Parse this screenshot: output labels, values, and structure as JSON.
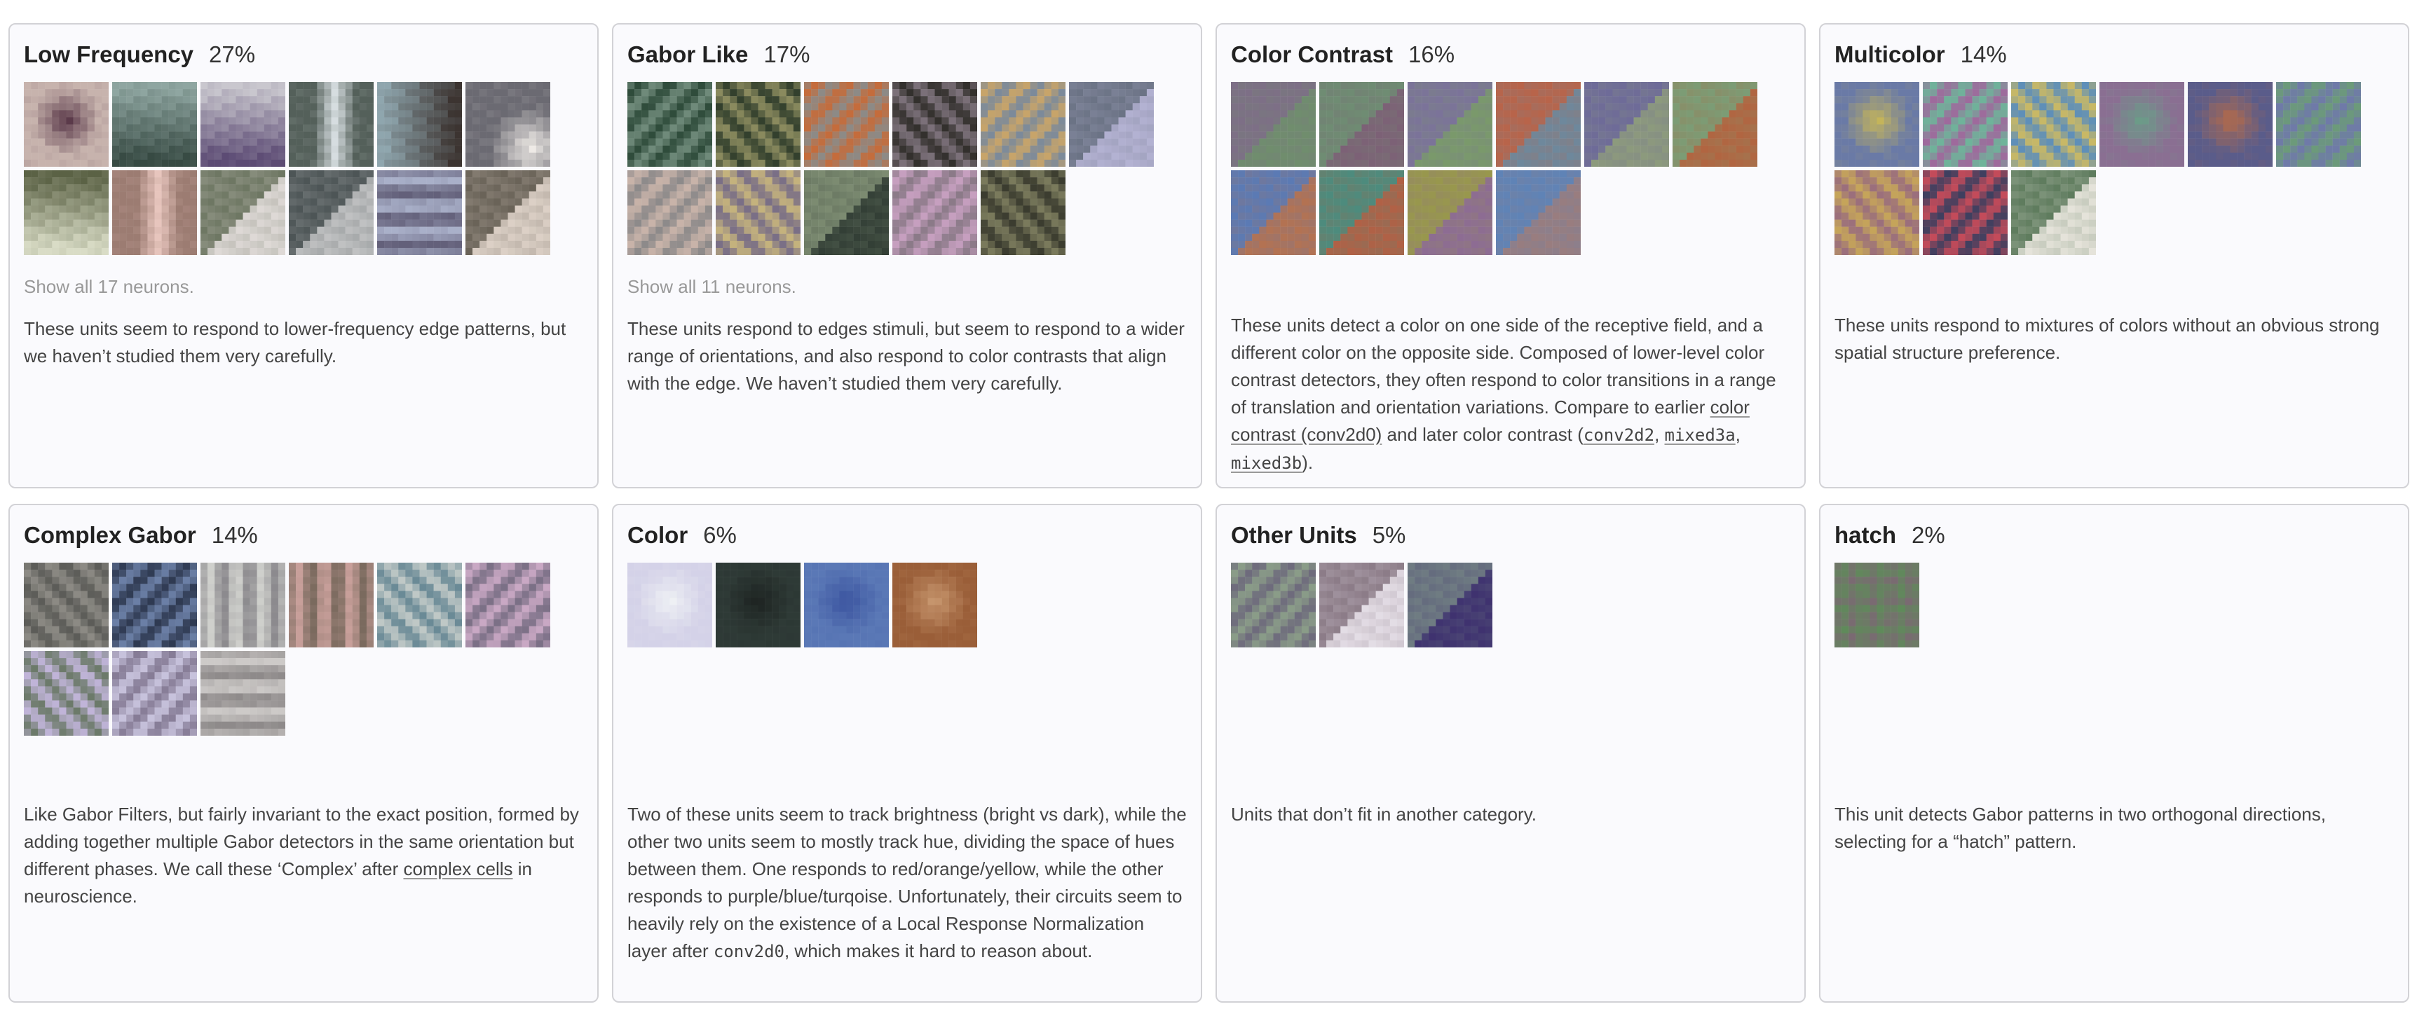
{
  "cards": [
    {
      "title": "Low Frequency",
      "percent": "27%",
      "show_all": "Show all 17 neurons.",
      "description": "These units seem to respond to lower-frequency edge patterns, but we haven’t studied them very carefully.",
      "swatches": [
        {
          "bg": "#c7b3ad",
          "tint": "#5b3a4a",
          "pattern": "blob"
        },
        {
          "bg": "#8fa6a1",
          "tint": "#374a43",
          "pattern": "grad-bottom"
        },
        {
          "bg": "#c9c7ce",
          "tint": "#5c4b74",
          "pattern": "grad-bottom"
        },
        {
          "bg": "#54605a",
          "tint": "#d6dde0",
          "pattern": "vbar"
        },
        {
          "bg": "#8fa6ae",
          "tint": "#3c3431",
          "pattern": "grad-right"
        },
        {
          "bg": "#6b6a72",
          "tint": "#eeeae6",
          "pattern": "blob-br"
        },
        {
          "bg": "#5b6245",
          "tint": "#d9dcc6",
          "pattern": "grad-bottom"
        },
        {
          "bg": "#9c7c72",
          "tint": "#e7c5bd",
          "pattern": "vbar"
        },
        {
          "bg": "#6e7763",
          "tint": "#e4dedc",
          "pattern": "diag"
        },
        {
          "bg": "#4d5556",
          "tint": "#c6c7c8",
          "pattern": "diag"
        },
        {
          "bg": "#63607a",
          "tint": "#a9b0c9",
          "pattern": "stripes-h"
        },
        {
          "bg": "#6a6358",
          "tint": "#e2d6cc",
          "pattern": "diag"
        }
      ]
    },
    {
      "title": "Gabor Like",
      "percent": "17%",
      "show_all": "Show all 11 neurons.",
      "description": "These units respond to edges stimuli, but seem to respond to a wider range of orientations, and also respond to color contrasts that align with the edge. We haven’t studied them very carefully.",
      "swatches": [
        {
          "bg": "#6f8a7a",
          "tint": "#2f4c3b",
          "pattern": "stripes-diag"
        },
        {
          "bg": "#8a8a5e",
          "tint": "#33402d",
          "pattern": "stripes-diag2"
        },
        {
          "bg": "#8d8a86",
          "tint": "#c46c3c",
          "pattern": "stripes-diag"
        },
        {
          "bg": "#7b7079",
          "tint": "#33302d",
          "pattern": "stripes-diag2"
        },
        {
          "bg": "#7c8a9a",
          "tint": "#c7a46a",
          "pattern": "stripes-diag"
        },
        {
          "bg": "#6b7385",
          "tint": "#b7b5d6",
          "pattern": "diag"
        },
        {
          "bg": "#8d8a8a",
          "tint": "#c8b3a9",
          "pattern": "stripes-diag"
        },
        {
          "bg": "#7a6f86",
          "tint": "#c4b27d",
          "pattern": "stripes-diag2"
        },
        {
          "bg": "#7c8b71",
          "tint": "#2f3b33",
          "pattern": "diag"
        },
        {
          "bg": "#8b7a88",
          "tint": "#c69fbf",
          "pattern": "stripes-diag"
        },
        {
          "bg": "#7a7a5c",
          "tint": "#3b3c2f",
          "pattern": "stripes-diag2"
        }
      ]
    },
    {
      "title": "Color Contrast",
      "percent": "16%",
      "show_all": "",
      "description": "",
      "swatches": [
        {
          "bg": "#7d6f86",
          "tint": "#6f8f6c",
          "pattern": "diag"
        },
        {
          "bg": "#6f8c73",
          "tint": "#7d5f76",
          "pattern": "diag"
        },
        {
          "bg": "#7b7399",
          "tint": "#7a9b69",
          "pattern": "diag"
        },
        {
          "bg": "#b8644a",
          "tint": "#6a8aa0",
          "pattern": "diag"
        },
        {
          "bg": "#6e6b98",
          "tint": "#8e9c7c",
          "pattern": "diag"
        },
        {
          "bg": "#7c9c75",
          "tint": "#b4623e",
          "pattern": "diag"
        },
        {
          "bg": "#5b7ab4",
          "tint": "#b8724d",
          "pattern": "diag"
        },
        {
          "bg": "#4d8b7d",
          "tint": "#b55f43",
          "pattern": "diag"
        },
        {
          "bg": "#98974d",
          "tint": "#8c6a97",
          "pattern": "diag"
        },
        {
          "bg": "#5f83b6",
          "tint": "#9c7d7c",
          "pattern": "diag"
        }
      ]
    },
    {
      "title": "Multicolor",
      "percent": "14%",
      "show_all": "",
      "description": "These units respond to mixtures of colors without an obvious strong spatial structure preference.",
      "swatches": [
        {
          "bg": "#6a7aa6",
          "tint": "#c4b45a",
          "pattern": "blob"
        },
        {
          "bg": "#9e6a9c",
          "tint": "#6fb39a",
          "pattern": "stripes-diag"
        },
        {
          "bg": "#c8b866",
          "tint": "#5f8fb8",
          "pattern": "stripes-diag2"
        },
        {
          "bg": "#8a6f92",
          "tint": "#6b9c88",
          "pattern": "blob"
        },
        {
          "bg": "#5a5c8a",
          "tint": "#b26a4a",
          "pattern": "blob"
        },
        {
          "bg": "#6f7aa8",
          "tint": "#6c9a7a",
          "pattern": "stripes-diag"
        },
        {
          "bg": "#9b6f7c",
          "tint": "#c5a45a",
          "pattern": "stripes-diag2"
        },
        {
          "bg": "#3f3f5f",
          "tint": "#c34b5a",
          "pattern": "stripes-diag"
        },
        {
          "bg": "#5f7c5e",
          "tint": "#ece8e0",
          "pattern": "diag"
        }
      ]
    },
    {
      "title": "Complex Gabor",
      "percent": "14%",
      "show_all": "",
      "description": "",
      "swatches": [
        {
          "bg": "#8c8a84",
          "tint": "#5c5c58",
          "pattern": "stripes-diag2"
        },
        {
          "bg": "#6b7fa6",
          "tint": "#2f3a52",
          "pattern": "stripes-diag"
        },
        {
          "bg": "#8c8a8e",
          "tint": "#cfd0cc",
          "pattern": "stripes-v"
        },
        {
          "bg": "#7a6a5e",
          "tint": "#c89f9a",
          "pattern": "stripes-v"
        },
        {
          "bg": "#6a8a96",
          "tint": "#bfc8c6",
          "pattern": "stripes-diag2"
        },
        {
          "bg": "#7b7086",
          "tint": "#c9a8c4",
          "pattern": "stripes-diag"
        },
        {
          "bg": "#6c7a6a",
          "tint": "#c0b4d8",
          "pattern": "stripes-diag2"
        },
        {
          "bg": "#867c96",
          "tint": "#c7c2dc",
          "pattern": "stripes-diag"
        },
        {
          "bg": "#8e8a8a",
          "tint": "#cdcac8",
          "pattern": "stripes-h"
        }
      ]
    },
    {
      "title": "Color",
      "percent": "6%",
      "show_all": "",
      "description": "",
      "swatches": [
        {
          "bg": "#d4d2e8",
          "tint": "#eef0f4",
          "pattern": "blob"
        },
        {
          "bg": "#2e3a36",
          "tint": "#1e2422",
          "pattern": "blob"
        },
        {
          "bg": "#5a78b6",
          "tint": "#3c55a0",
          "pattern": "blob"
        },
        {
          "bg": "#9a5e38",
          "tint": "#c7966e",
          "pattern": "blob"
        }
      ]
    },
    {
      "title": "Other Units",
      "percent": "5%",
      "show_all": "",
      "description": "Units that don’t fit in another category.",
      "swatches": [
        {
          "bg": "#6e6b7c",
          "tint": "#8a9c88",
          "pattern": "stripes-diag"
        },
        {
          "bg": "#8c7c88",
          "tint": "#e8e2ea",
          "pattern": "diag"
        },
        {
          "bg": "#6f7c82",
          "tint": "#3c2e6e",
          "pattern": "diag"
        }
      ]
    },
    {
      "title": "hatch",
      "percent": "2%",
      "show_all": "",
      "description": "This unit detects Gabor patterns in two orthogonal directions, selecting for a “hatch” pattern.",
      "swatches": [
        {
          "bg": "#7a6a72",
          "tint": "#5f8a5a",
          "pattern": "hatch"
        }
      ]
    }
  ],
  "rich": {
    "cc": {
      "t1": "These units detect a color on one side of the receptive field, and a different color on the opposite side. Composed of lower-level color contrast detectors, they often respond to color transitions in a range of translation and orientation variations. Compare to earlier ",
      "link1": "color contrast (conv2d0)",
      "t2": " and later color contrast (",
      "l2": "conv2d2",
      "t3": ", ",
      "l3": "mixed3a",
      "t4": ", ",
      "l4": "mixed3b",
      "t5": ")."
    },
    "cg": {
      "t1": "Like Gabor Filters, but fairly invariant to the exact position, formed by adding together multiple Gabor detectors in the same orientation but different phases. We call these ‘Complex’ after ",
      "link": "complex cells",
      "t2": " in neuroscience."
    },
    "col": {
      "t1": "Two of these units seem to track brightness (bright vs dark), while the other two units seem to mostly track hue, dividing the space of hues between them. One responds to red/orange/yellow, while the other responds to purple/blue/turqoise. Unfortunately, their circuits seem to heavily rely on the existence of a Local Response Normalization layer after ",
      "code": "conv2d0",
      "t2": ", which makes it hard to reason about."
    }
  }
}
